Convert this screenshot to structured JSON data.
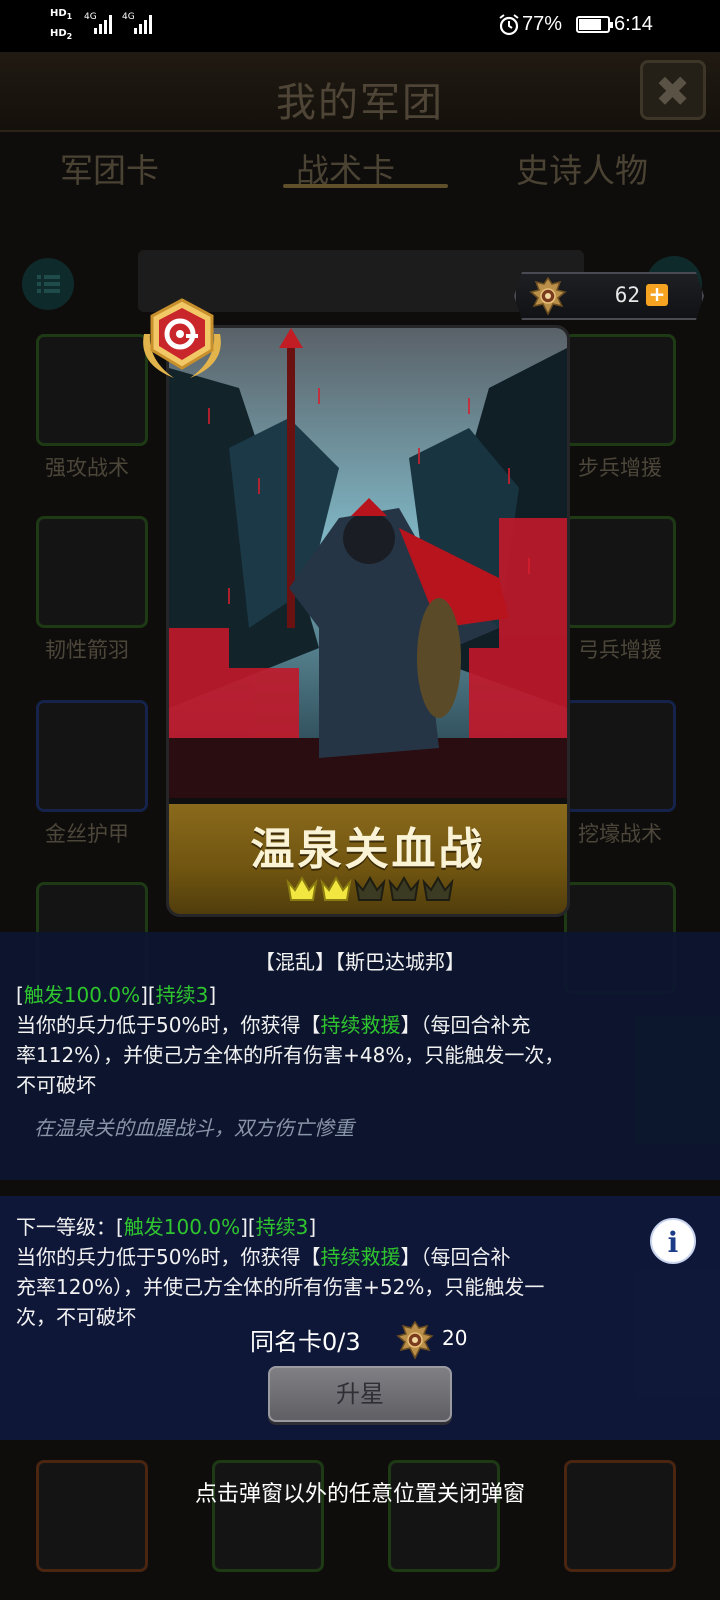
{
  "status_bar": {
    "hd1": "HD",
    "hd1_sub": "1",
    "hd2": "HD",
    "hd2_sub": "2",
    "network1": "4G",
    "network2": "4G",
    "battery_percent": "77%",
    "battery_level": 0.77,
    "time": "6:14"
  },
  "background": {
    "title": "我的军团",
    "tabs": [
      "军团卡",
      "战术卡",
      "史诗人物"
    ],
    "active_tab_index": 1,
    "card_labels": [
      "强攻战术",
      "步兵增援",
      "韧性箭羽",
      "弓兵增援",
      "金丝护甲",
      "挖壕战术"
    ]
  },
  "currency": {
    "value": "62",
    "plus": "+",
    "emblem_icon": "eagle-emblem-icon"
  },
  "card": {
    "name": "温泉关血战",
    "stars_filled": 2,
    "stars_total": 5
  },
  "description": {
    "tags": "【混乱】【斯巴达城邦】",
    "trigger": "触发100.0%",
    "duration": "持续3",
    "line1_a": "当你的兵力低于50%时，你获得【",
    "buff": "持续救援",
    "line1_b": "】（每回合补充",
    "line2": "率112%），并使己方全体的所有伤害+48%，只能触发一次，",
    "line3": "不可破坏",
    "flavor": "在温泉关的血腥战斗，双方伤亡惨重"
  },
  "next_level": {
    "prefix": "下一等级：",
    "trigger": "触发100.0%",
    "duration": "持续3",
    "line1_a": "当你的兵力低于50%时，你获得【",
    "buff": "持续救援",
    "line1_b": "】（每回合补",
    "line2": "充率120%），并使己方全体的所有伤害+52%，只能触发一",
    "line3": "次，不可破坏"
  },
  "upgrade": {
    "duplicate_label": "同名卡0/3",
    "cost": "20",
    "button_label": "升星"
  },
  "close_hint": "点击弹窗以外的任意位置关闭弹窗",
  "colors": {
    "highlight_green": "#2ec52e",
    "panel_navy": "#0c162e",
    "accent_orange": "#f5a320",
    "gold_bar": "#8a6a1c"
  }
}
